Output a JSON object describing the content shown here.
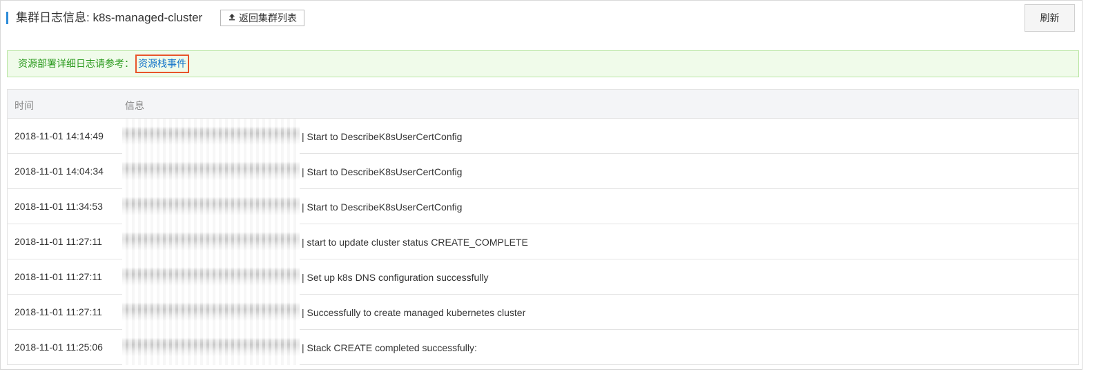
{
  "header": {
    "title": "集群日志信息: k8s-managed-cluster",
    "back_button": {
      "icon": "upload-icon",
      "label": "返回集群列表"
    },
    "refresh_button": "刷新"
  },
  "notice": {
    "text": "资源部署详细日志请参考：",
    "link_text": "资源栈事件"
  },
  "table": {
    "columns": [
      "时间",
      "信息"
    ],
    "rows": [
      {
        "time": "2018-11-01 14:14:49",
        "message": "| Start to DescribeK8sUserCertConfig"
      },
      {
        "time": "2018-11-01 14:04:34",
        "message": "| Start to DescribeK8sUserCertConfig"
      },
      {
        "time": "2018-11-01 11:34:53",
        "message": "| Start to DescribeK8sUserCertConfig"
      },
      {
        "time": "2018-11-01 11:27:11",
        "message": "| start to update cluster status CREATE_COMPLETE"
      },
      {
        "time": "2018-11-01 11:27:11",
        "message": "| Set up k8s DNS configuration successfully"
      },
      {
        "time": "2018-11-01 11:27:11",
        "message": "| Successfully to create managed kubernetes cluster"
      },
      {
        "time": "2018-11-01 11:25:06",
        "message": "| Stack CREATE completed successfully:"
      }
    ]
  },
  "colors": {
    "accent": "#2c8bd8",
    "notice_bg": "#f0fbea",
    "notice_text": "#2c9b1f",
    "link": "#1273c9",
    "highlight_border": "#e8542a"
  }
}
